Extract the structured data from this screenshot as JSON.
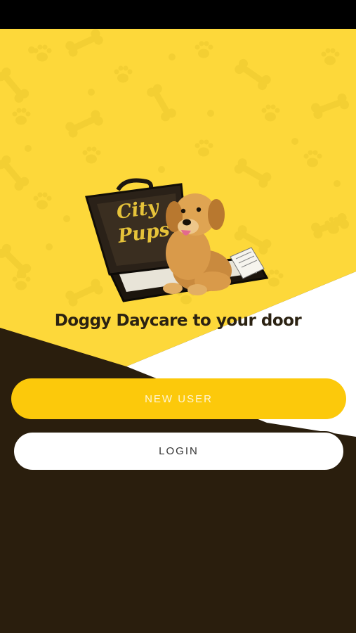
{
  "app": {
    "brand_line1": "City",
    "brand_line2": "Pups",
    "tagline": "Doggy Daycare to your door"
  },
  "actions": {
    "new_user_label": "NEW USER",
    "login_label": "LOGIN"
  },
  "colors": {
    "brand_yellow": "#fcc90b",
    "dark_brown": "#2a1e0d",
    "pattern_yellow": "#f2c81e",
    "white": "#ffffff"
  },
  "icons": [
    "bone-icon",
    "paw-print-icon",
    "briefcase-icon",
    "puppy-illustration"
  ]
}
